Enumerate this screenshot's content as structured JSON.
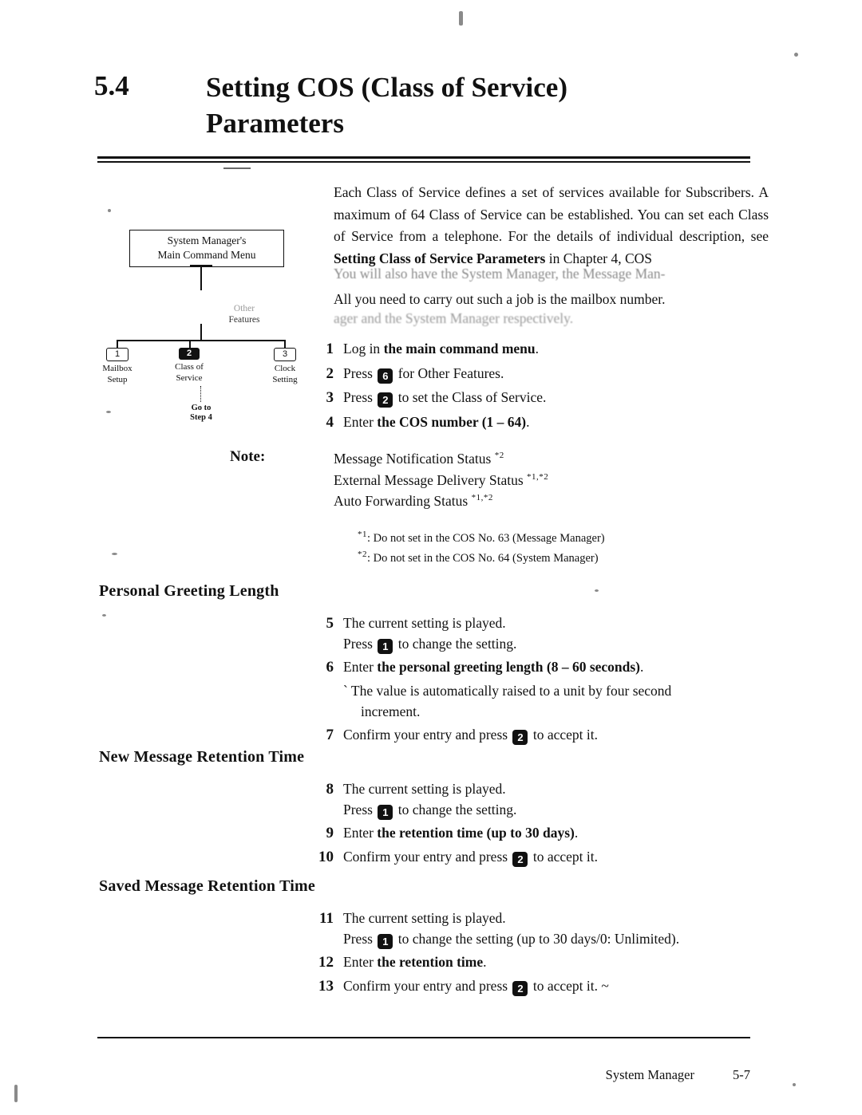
{
  "document": {
    "section_number": "5.4",
    "title_line1": "Setting COS (Class of Service)",
    "title_line2": "Parameters",
    "intro": "Each Class of Service defines a set of services available for Subscribers.  A maximum of 64 Class of Service can be established.  You can set each Class of Service from a telephone.   For  the  details  of  individual  description,  see ",
    "intro_bold": "Setting Class of Service Parameters",
    "intro_tail": " in Chapter 4, COS",
    "ghost_line1": "You will also have the System Manager, the Message Man-",
    "ghost_line2": "All you need to carry out such a job is the mailbox number.",
    "ghost_line3": "ager and the System Manager respectively."
  },
  "flowchart": {
    "root_line1": "System Manager's",
    "root_line2": "Main Command Menu",
    "branch_label_line1": "Other",
    "branch_label_line2": "Features",
    "nodes": [
      {
        "key": "1",
        "filled": false,
        "label_line1": "Mailbox",
        "label_line2": "Setup"
      },
      {
        "key": "2",
        "filled": true,
        "label_line1": "Class of",
        "label_line2": "Service"
      },
      {
        "key": "3",
        "filled": false,
        "label_line1": "Clock",
        "label_line2": "Setting"
      }
    ],
    "goto_line1": "Go to",
    "goto_line2": "Step 4"
  },
  "steps_main": [
    {
      "num": "1",
      "pre": "Log in ",
      "bold": "the main command menu",
      "post": "."
    },
    {
      "num": "2",
      "pre": "Press ",
      "key": "6",
      "post": " for Other Features."
    },
    {
      "num": "3",
      "pre": "Press ",
      "key": "2",
      "post": " to set the Class of Service."
    },
    {
      "num": "4",
      "pre": "Enter ",
      "bold": "the COS number (1 – 64)",
      "post": "."
    }
  ],
  "note": {
    "label": "Note:",
    "lines": [
      {
        "text": "Message Notification Status ",
        "sup": "*2"
      },
      {
        "text": "External Message Delivery Status ",
        "sup": "*1,*2"
      },
      {
        "text": "Auto Forwarding Status ",
        "sup": "*1,*2"
      }
    ],
    "footnotes": [
      {
        "mark": "*1",
        "text": ": Do not set in the COS No. 63 (Message Manager)"
      },
      {
        "mark": "*2",
        "text": ": Do not set in the COS No. 64 (System Manager)"
      }
    ]
  },
  "sections": [
    {
      "heading": "Personal Greeting Length",
      "steps": [
        {
          "num": "5",
          "line1": "The current setting is played.",
          "line2_pre": "Press ",
          "key": "1",
          "line2_post": " to change the setting."
        },
        {
          "num": "6",
          "pre": "Enter ",
          "bold": "the personal greeting length (8 – 60 seconds)",
          "post": "."
        },
        {
          "num": "",
          "sub_marker": "`",
          "sub_line1": " The value is automatically raised to a unit by four second",
          "sub_line2": "increment."
        },
        {
          "num": "7",
          "pre": "Confirm your entry and press ",
          "key": "2",
          "post": " to accept it."
        }
      ]
    },
    {
      "heading": "New Message Retention Time",
      "steps": [
        {
          "num": "8",
          "line1": "The current setting is played.",
          "line2_pre": "Press ",
          "key": "1",
          "line2_post": " to change the setting."
        },
        {
          "num": "9",
          "pre": "Enter ",
          "bold": "the retention time (up to 30 days)",
          "post": "."
        },
        {
          "num": "10",
          "pre": "Confirm your entry and press ",
          "key": "2",
          "post": " to accept it."
        }
      ]
    },
    {
      "heading": "Saved Message Retention Time",
      "steps": [
        {
          "num": "11",
          "line1": "The current setting is played.",
          "line2_pre": "Press ",
          "key": "1",
          "line2_post": " to change the setting (up to 30 days/0: Unlimited)."
        },
        {
          "num": "12",
          "pre": "Enter ",
          "bold": "the retention time",
          "post": "."
        },
        {
          "num": "13",
          "pre": "Confirm your entry and press ",
          "key": "2",
          "post": " to accept it.  ~"
        }
      ]
    }
  ],
  "footer": {
    "left": "System Manager",
    "page": "5-7"
  }
}
